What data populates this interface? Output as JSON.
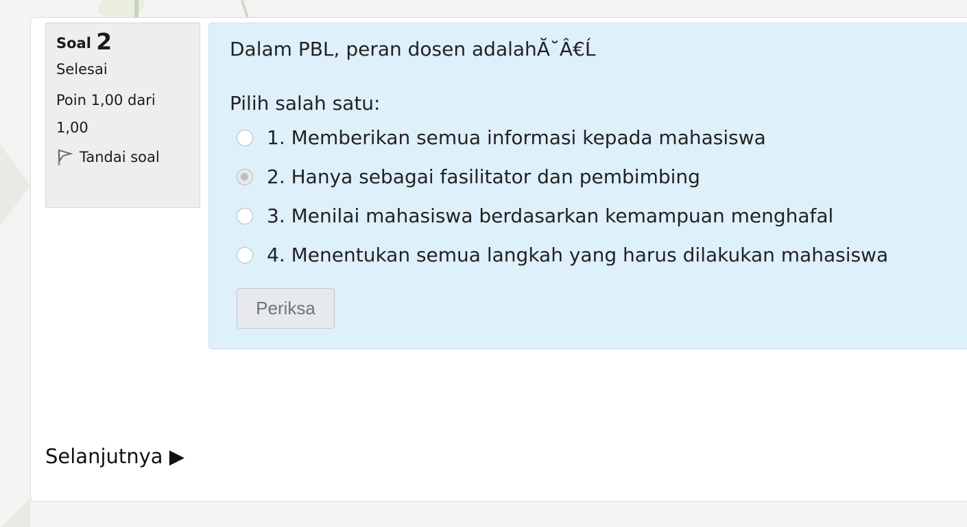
{
  "info": {
    "question_label": "Soal",
    "question_number": "2",
    "state": "Selesai",
    "grade_line1": "Poin 1,00 dari",
    "grade_line2": "1,00",
    "flag_label": "Tandai soal",
    "flag_icon": "flag-icon"
  },
  "question": {
    "text": "Dalam PBL, peran dosen adalahĂ˘Â€Ĺ",
    "prompt": "Pilih salah satu:",
    "options": [
      {
        "label": "1. Memberikan semua informasi kepada mahasiswa",
        "selected": false
      },
      {
        "label": "2. Hanya sebagai fasilitator dan pembimbing",
        "selected": true
      },
      {
        "label": "3. Menilai mahasiswa berdasarkan kemampuan menghafal",
        "selected": false
      },
      {
        "label": "4. Menentukan semua langkah yang harus dilakukan mahasiswa",
        "selected": false
      }
    ],
    "check_button": "Periksa"
  },
  "navigation": {
    "next_label": "Selanjutnya ▶"
  },
  "colors": {
    "content_bg": "#def0fa",
    "info_bg": "#eeeeee",
    "button_bg": "#e7e9ec"
  }
}
